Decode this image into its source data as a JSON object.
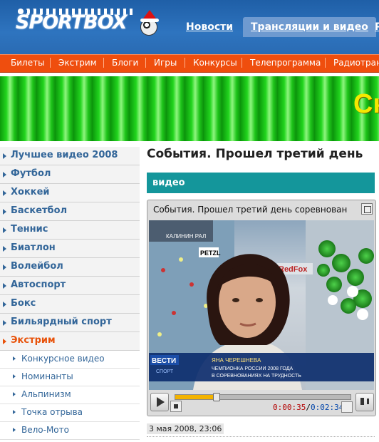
{
  "header": {
    "logo_text": "SPORTBOX",
    "nav": {
      "news": "Новости",
      "video": "Трансляции и видео",
      "more": "Р"
    }
  },
  "menu": {
    "items": [
      "Билеты",
      "Экстрим",
      "Блоги",
      "Игры",
      "Конкурсы",
      "Телепрограмма",
      "Радиотран"
    ]
  },
  "banner": {
    "text": "Ск"
  },
  "sidebar": {
    "items": [
      "Лучшее видео 2008",
      "Футбол",
      "Хоккей",
      "Баскетбол",
      "Теннис",
      "Биатлон",
      "Волейбол",
      "Автоспорт",
      "Бокс",
      "Бильярдный спорт",
      "Экстрим"
    ],
    "active": "Экстрим",
    "subitems": [
      "Конкурсное видео",
      "Номинанты",
      "Альпинизм",
      "Точка отрыва",
      "Вело-Мото"
    ]
  },
  "article": {
    "title": "События. Прошел третий день",
    "section": "видео",
    "date": "3 мая 2008, 23:06"
  },
  "player": {
    "title": "События.  Прошел третий день соревнован",
    "progress": 0.23,
    "time_current": "0:00:35",
    "time_total": "0:02:34",
    "video": {
      "caption_name": "ЯНА ЧЕРЕШНЕВА",
      "caption_line1": "ЧЕМПИОНКА РОССИИ 2008 ГОДА",
      "caption_line2": "В СОРЕВНОВАНИЯХ НА ТРУДНОСТЬ",
      "channel_logo": "ВЕСТИ",
      "channel_sub": "СПОРТ",
      "wall_sign": "КАЛИНИН РАЛ",
      "sponsor1": "PETZL",
      "sponsor2": "RedFox"
    }
  },
  "colors": {
    "header_blue": "#2a6bb3",
    "menu_orange": "#ef4e0e",
    "section_teal": "#14969b",
    "link_blue": "#336699",
    "active_orange": "#e8520a"
  }
}
